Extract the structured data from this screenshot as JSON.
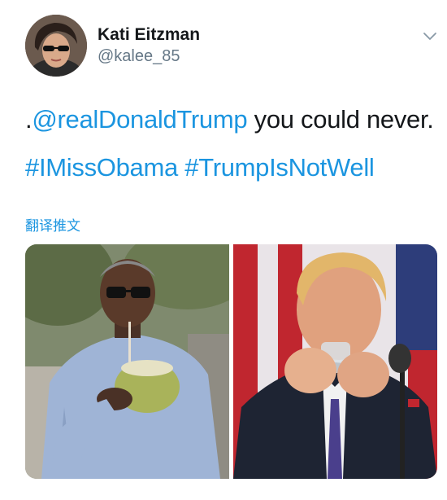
{
  "author": {
    "name": "Kati Eitzman",
    "handle": "@kalee_85",
    "avatar_icon": "avatar-photo"
  },
  "tweet": {
    "prefix": ".",
    "mention": "@realDonaldTrump",
    "text_rest": " you could never.",
    "hashtag_1": "#IMissObama",
    "hashtag_2": "#TrumpIsNotWell"
  },
  "translate_label": "翻译推文",
  "colors": {
    "link": "#1b95e0",
    "secondary_text": "#657786",
    "primary_text": "#14171a"
  },
  "icons": {
    "menu": "chevron-down-icon"
  }
}
